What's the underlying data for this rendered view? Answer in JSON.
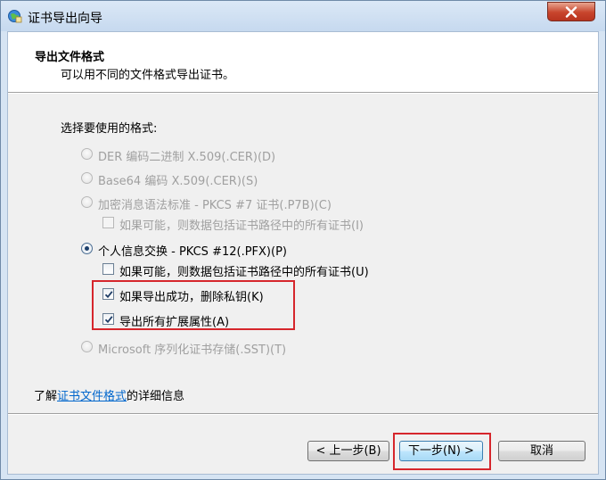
{
  "window": {
    "title": "证书导出向导",
    "close_label": "close"
  },
  "header": {
    "title": "导出文件格式",
    "subtitle": "可以用不同的文件格式导出证书。"
  },
  "format_prompt": "选择要使用的格式:",
  "options": {
    "der": "DER 编码二进制 X.509(.CER)(D)",
    "base64": "Base64 编码 X.509(.CER)(S)",
    "pkcs7": "加密消息语法标准 - PKCS #7 证书(.P7B)(C)",
    "pkcs7_include_path": "如果可能，则数据包括证书路径中的所有证书(I)",
    "pkcs12": "个人信息交换 - PKCS #12(.PFX)(P)",
    "pkcs12_include_path": "如果可能，则数据包括证书路径中的所有证书(U)",
    "pkcs12_delete_key": "如果导出成功，删除私钥(K)",
    "pkcs12_export_props": "导出所有扩展属性(A)",
    "sst": "Microsoft 序列化证书存储(.SST)(T)"
  },
  "state": {
    "selected_format": "pkcs12",
    "pkcs7_include_path": false,
    "pkcs12_include_path": false,
    "pkcs12_delete_key": true,
    "pkcs12_export_props": true
  },
  "learn_more": {
    "prefix": "了解",
    "link": "证书文件格式",
    "suffix": "的详细信息"
  },
  "buttons": {
    "back": "< 上一步(B)",
    "next": "下一步(N) >",
    "cancel": "取消"
  },
  "colors": {
    "highlight": "#d6262c",
    "link": "#0066cc"
  }
}
